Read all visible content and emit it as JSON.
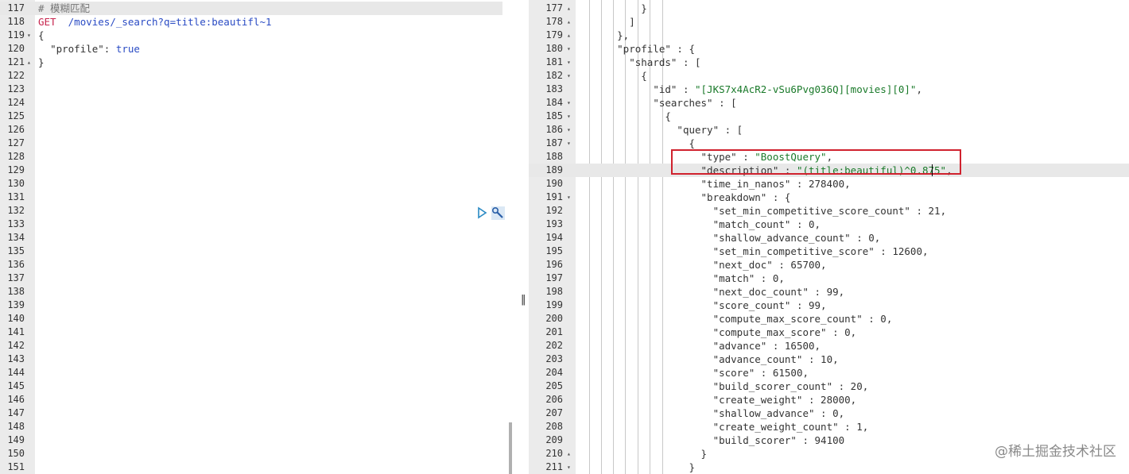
{
  "left_editor": {
    "lines": [
      {
        "n": "117",
        "fold": "",
        "html": "<span class=\"c\"># 模糊匹配</span>"
      },
      {
        "n": "118",
        "fold": "",
        "html": "<span class=\"m\">GET</span>  <span class=\"b\">/movies/_search?q=title:beautifl~1</span>"
      },
      {
        "n": "119",
        "fold": "▾",
        "html": "{"
      },
      {
        "n": "120",
        "fold": "",
        "html": "  <span class=\"k\">\"profile\"</span>: <span class=\"b\">true</span>"
      },
      {
        "n": "121",
        "fold": "▴",
        "html": "}"
      },
      {
        "n": "122",
        "fold": "",
        "html": ""
      },
      {
        "n": "123",
        "fold": "",
        "html": ""
      },
      {
        "n": "124",
        "fold": "",
        "html": ""
      },
      {
        "n": "125",
        "fold": "",
        "html": ""
      },
      {
        "n": "126",
        "fold": "",
        "html": ""
      },
      {
        "n": "127",
        "fold": "",
        "html": ""
      },
      {
        "n": "128",
        "fold": "",
        "html": ""
      },
      {
        "n": "129",
        "fold": "",
        "html": ""
      },
      {
        "n": "130",
        "fold": "",
        "html": ""
      },
      {
        "n": "131",
        "fold": "",
        "html": ""
      },
      {
        "n": "132",
        "fold": "",
        "html": ""
      },
      {
        "n": "133",
        "fold": "",
        "html": ""
      },
      {
        "n": "134",
        "fold": "",
        "html": ""
      },
      {
        "n": "135",
        "fold": "",
        "html": ""
      },
      {
        "n": "136",
        "fold": "",
        "html": ""
      },
      {
        "n": "137",
        "fold": "",
        "html": ""
      },
      {
        "n": "138",
        "fold": "",
        "html": ""
      },
      {
        "n": "139",
        "fold": "",
        "html": ""
      },
      {
        "n": "140",
        "fold": "",
        "html": ""
      },
      {
        "n": "141",
        "fold": "",
        "html": ""
      },
      {
        "n": "142",
        "fold": "",
        "html": ""
      },
      {
        "n": "143",
        "fold": "",
        "html": ""
      },
      {
        "n": "144",
        "fold": "",
        "html": ""
      },
      {
        "n": "145",
        "fold": "",
        "html": ""
      },
      {
        "n": "146",
        "fold": "",
        "html": ""
      },
      {
        "n": "147",
        "fold": "",
        "html": ""
      },
      {
        "n": "148",
        "fold": "",
        "html": ""
      },
      {
        "n": "149",
        "fold": "",
        "html": ""
      },
      {
        "n": "150",
        "fold": "",
        "html": ""
      },
      {
        "n": "151",
        "fold": "",
        "html": ""
      }
    ]
  },
  "right_editor": {
    "lines": [
      {
        "n": "177",
        "fold": "▴",
        "html": "          }"
      },
      {
        "n": "178",
        "fold": "▴",
        "html": "        ]"
      },
      {
        "n": "179",
        "fold": "▴",
        "html": "      },"
      },
      {
        "n": "180",
        "fold": "▾",
        "html": "      <span class=\"k\">\"profile\"</span> : {"
      },
      {
        "n": "181",
        "fold": "▾",
        "html": "        <span class=\"k\">\"shards\"</span> : ["
      },
      {
        "n": "182",
        "fold": "▾",
        "html": "          {"
      },
      {
        "n": "183",
        "fold": "",
        "html": "            <span class=\"k\">\"id\"</span> : <span class=\"s\">\"[JKS7x4AcR2-vSu6Pvg036Q][movies][0]\"</span>,"
      },
      {
        "n": "184",
        "fold": "▾",
        "html": "            <span class=\"k\">\"searches\"</span> : ["
      },
      {
        "n": "185",
        "fold": "▾",
        "html": "              {"
      },
      {
        "n": "186",
        "fold": "▾",
        "html": "                <span class=\"k\">\"query\"</span> : ["
      },
      {
        "n": "187",
        "fold": "▾",
        "html": "                  {"
      },
      {
        "n": "188",
        "fold": "",
        "html": "                    <span class=\"k\">\"type\"</span> : <span class=\"s\">\"BoostQuery\"</span>,"
      },
      {
        "n": "189",
        "fold": "",
        "html": "                    <span class=\"k\">\"description\"</span> : <span class=\"s\">\"(title:beautiful)^0.875\"</span>,"
      },
      {
        "n": "190",
        "fold": "",
        "html": "                    <span class=\"k\">\"time_in_nanos\"</span> : 278400,"
      },
      {
        "n": "191",
        "fold": "▾",
        "html": "                    <span class=\"k\">\"breakdown\"</span> : {"
      },
      {
        "n": "192",
        "fold": "",
        "html": "                      <span class=\"k\">\"set_min_competitive_score_count\"</span> : 21,"
      },
      {
        "n": "193",
        "fold": "",
        "html": "                      <span class=\"k\">\"match_count\"</span> : 0,"
      },
      {
        "n": "194",
        "fold": "",
        "html": "                      <span class=\"k\">\"shallow_advance_count\"</span> : 0,"
      },
      {
        "n": "195",
        "fold": "",
        "html": "                      <span class=\"k\">\"set_min_competitive_score\"</span> : 12600,"
      },
      {
        "n": "196",
        "fold": "",
        "html": "                      <span class=\"k\">\"next_doc\"</span> : 65700,"
      },
      {
        "n": "197",
        "fold": "",
        "html": "                      <span class=\"k\">\"match\"</span> : 0,"
      },
      {
        "n": "198",
        "fold": "",
        "html": "                      <span class=\"k\">\"next_doc_count\"</span> : 99,"
      },
      {
        "n": "199",
        "fold": "",
        "html": "                      <span class=\"k\">\"score_count\"</span> : 99,"
      },
      {
        "n": "200",
        "fold": "",
        "html": "                      <span class=\"k\">\"compute_max_score_count\"</span> : 0,"
      },
      {
        "n": "201",
        "fold": "",
        "html": "                      <span class=\"k\">\"compute_max_score\"</span> : 0,"
      },
      {
        "n": "202",
        "fold": "",
        "html": "                      <span class=\"k\">\"advance\"</span> : 16500,"
      },
      {
        "n": "203",
        "fold": "",
        "html": "                      <span class=\"k\">\"advance_count\"</span> : 10,"
      },
      {
        "n": "204",
        "fold": "",
        "html": "                      <span class=\"k\">\"score\"</span> : 61500,"
      },
      {
        "n": "205",
        "fold": "",
        "html": "                      <span class=\"k\">\"build_scorer_count\"</span> : 20,"
      },
      {
        "n": "206",
        "fold": "",
        "html": "                      <span class=\"k\">\"create_weight\"</span> : 28000,"
      },
      {
        "n": "207",
        "fold": "",
        "html": "                      <span class=\"k\">\"shallow_advance\"</span> : 0,"
      },
      {
        "n": "208",
        "fold": "",
        "html": "                      <span class=\"k\">\"create_weight_count\"</span> : 1,"
      },
      {
        "n": "209",
        "fold": "",
        "html": "                      <span class=\"k\">\"build_scorer\"</span> : 94100"
      },
      {
        "n": "210",
        "fold": "▴",
        "html": "                    }"
      },
      {
        "n": "211",
        "fold": "▾",
        "html": "                  }"
      }
    ]
  },
  "icons": {
    "run": "play-icon",
    "settings": "wrench-icon"
  },
  "divider_glyph": "‖",
  "watermark": "@稀土掘金技术社区",
  "colors": {
    "highlight_border": "#d0222e",
    "string": "#1a7a2a",
    "method": "#c7254e",
    "value": "#2a4bc4"
  }
}
